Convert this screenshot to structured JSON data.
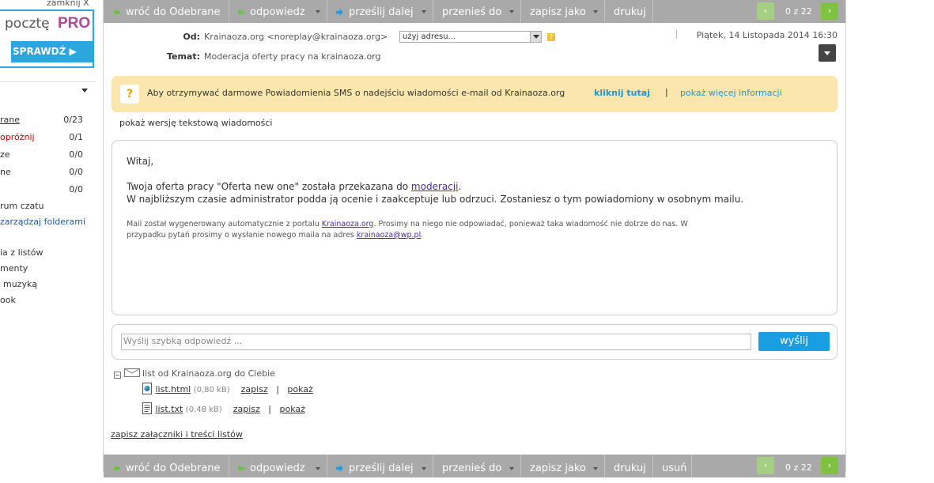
{
  "sidebar": {
    "close_ad": "zamknij X",
    "promo_text": "pocztę",
    "promo_pro": "PRO",
    "promo_button": "SPRAWDŹ",
    "folders": [
      {
        "name": "rane",
        "count": "0/23"
      },
      {
        "name": "opróżnij",
        "count": "0/1"
      },
      {
        "name": "ze",
        "count": "0/0"
      },
      {
        "name": "ne",
        "count": "0/0"
      },
      {
        "name": "",
        "count": "0/0"
      }
    ],
    "links": [
      "rum czatu",
      "zarządzaj folderami",
      "ia z listów",
      "menty",
      "muzyką",
      "ook"
    ]
  },
  "toolbar": {
    "back": "wróć do Odebrane",
    "reply": "odpowiedz",
    "forward": "prześlij dalej",
    "move": "przenieś do",
    "save_as": "zapisz jako",
    "print": "drukuj",
    "delete": "usuń",
    "pager": "0 z 22",
    "prev": "‹",
    "next": "›"
  },
  "header": {
    "from_label": "Od:",
    "from_value": "Krainaoza.org <noreplay@krainaoza.org>",
    "address_select": "użyj adresu...",
    "subject_label": "Temat:",
    "subject_value": "Moderacja oferty pracy na krainaoza.org",
    "date": "Piątek, 14 Listopada 2014 16:30"
  },
  "sms_banner": {
    "message": "Aby otrzymywać darmowe Powiadomienia SMS o nadejściu wiadomości e-mail od Krainaoza.org",
    "click_here": "kliknij tutaj",
    "separator": "|",
    "more_info": "pokaż więcej informacji"
  },
  "text_version_link": "pokaż wersję tekstową wiadomości",
  "message": {
    "greeting": "Witaj,",
    "line1_pre": "Twoja oferta pracy \"Oferta new one\" została przekazana do",
    "line1_link": "moderacji",
    "line1_post": ".",
    "line2": "W najbliższym czasie administrator podda ją ocenie i zaakceptuje lub odrzuci. Zostaniesz o tym powiadomiony w osobnym mailu.",
    "footer1_pre": "Mail został wygenerowany automatycznie z portalu",
    "footer1_link": "Krainaoza.org",
    "footer1_post": ". Prosimy na niego nie odpowiadać, ponieważ taka wiadomość nie dotrze do nas. W",
    "footer2_pre": "przypadku pytań prosimy o wysłanie nowego maila na adres",
    "footer2_link": "krainaoza@wp.pl",
    "footer2_post": "."
  },
  "quick_reply": {
    "placeholder": "Wyślij szybką odpowiedź ...",
    "send": "wyślij"
  },
  "attachments": {
    "title": "list od Krainaoza.org do Ciebie",
    "files": [
      {
        "name": "list.html",
        "size": "(0,80 kB)",
        "save": "zapisz",
        "sep": "|",
        "show": "pokaż",
        "icon": "html-file-icon"
      },
      {
        "name": "list.txt",
        "size": "(0,48 kB)",
        "save": "zapisz",
        "sep": "|",
        "show": "pokaż",
        "icon": "text-file-icon"
      }
    ],
    "save_all": "zapisz załączniki i treści listów"
  },
  "colors": {
    "toolbar": "#a9a9a9",
    "accent": "#1a9ee2",
    "banner": "#fbe7ae",
    "nav": "#7fc242",
    "promo_pro": "#b04a97"
  }
}
